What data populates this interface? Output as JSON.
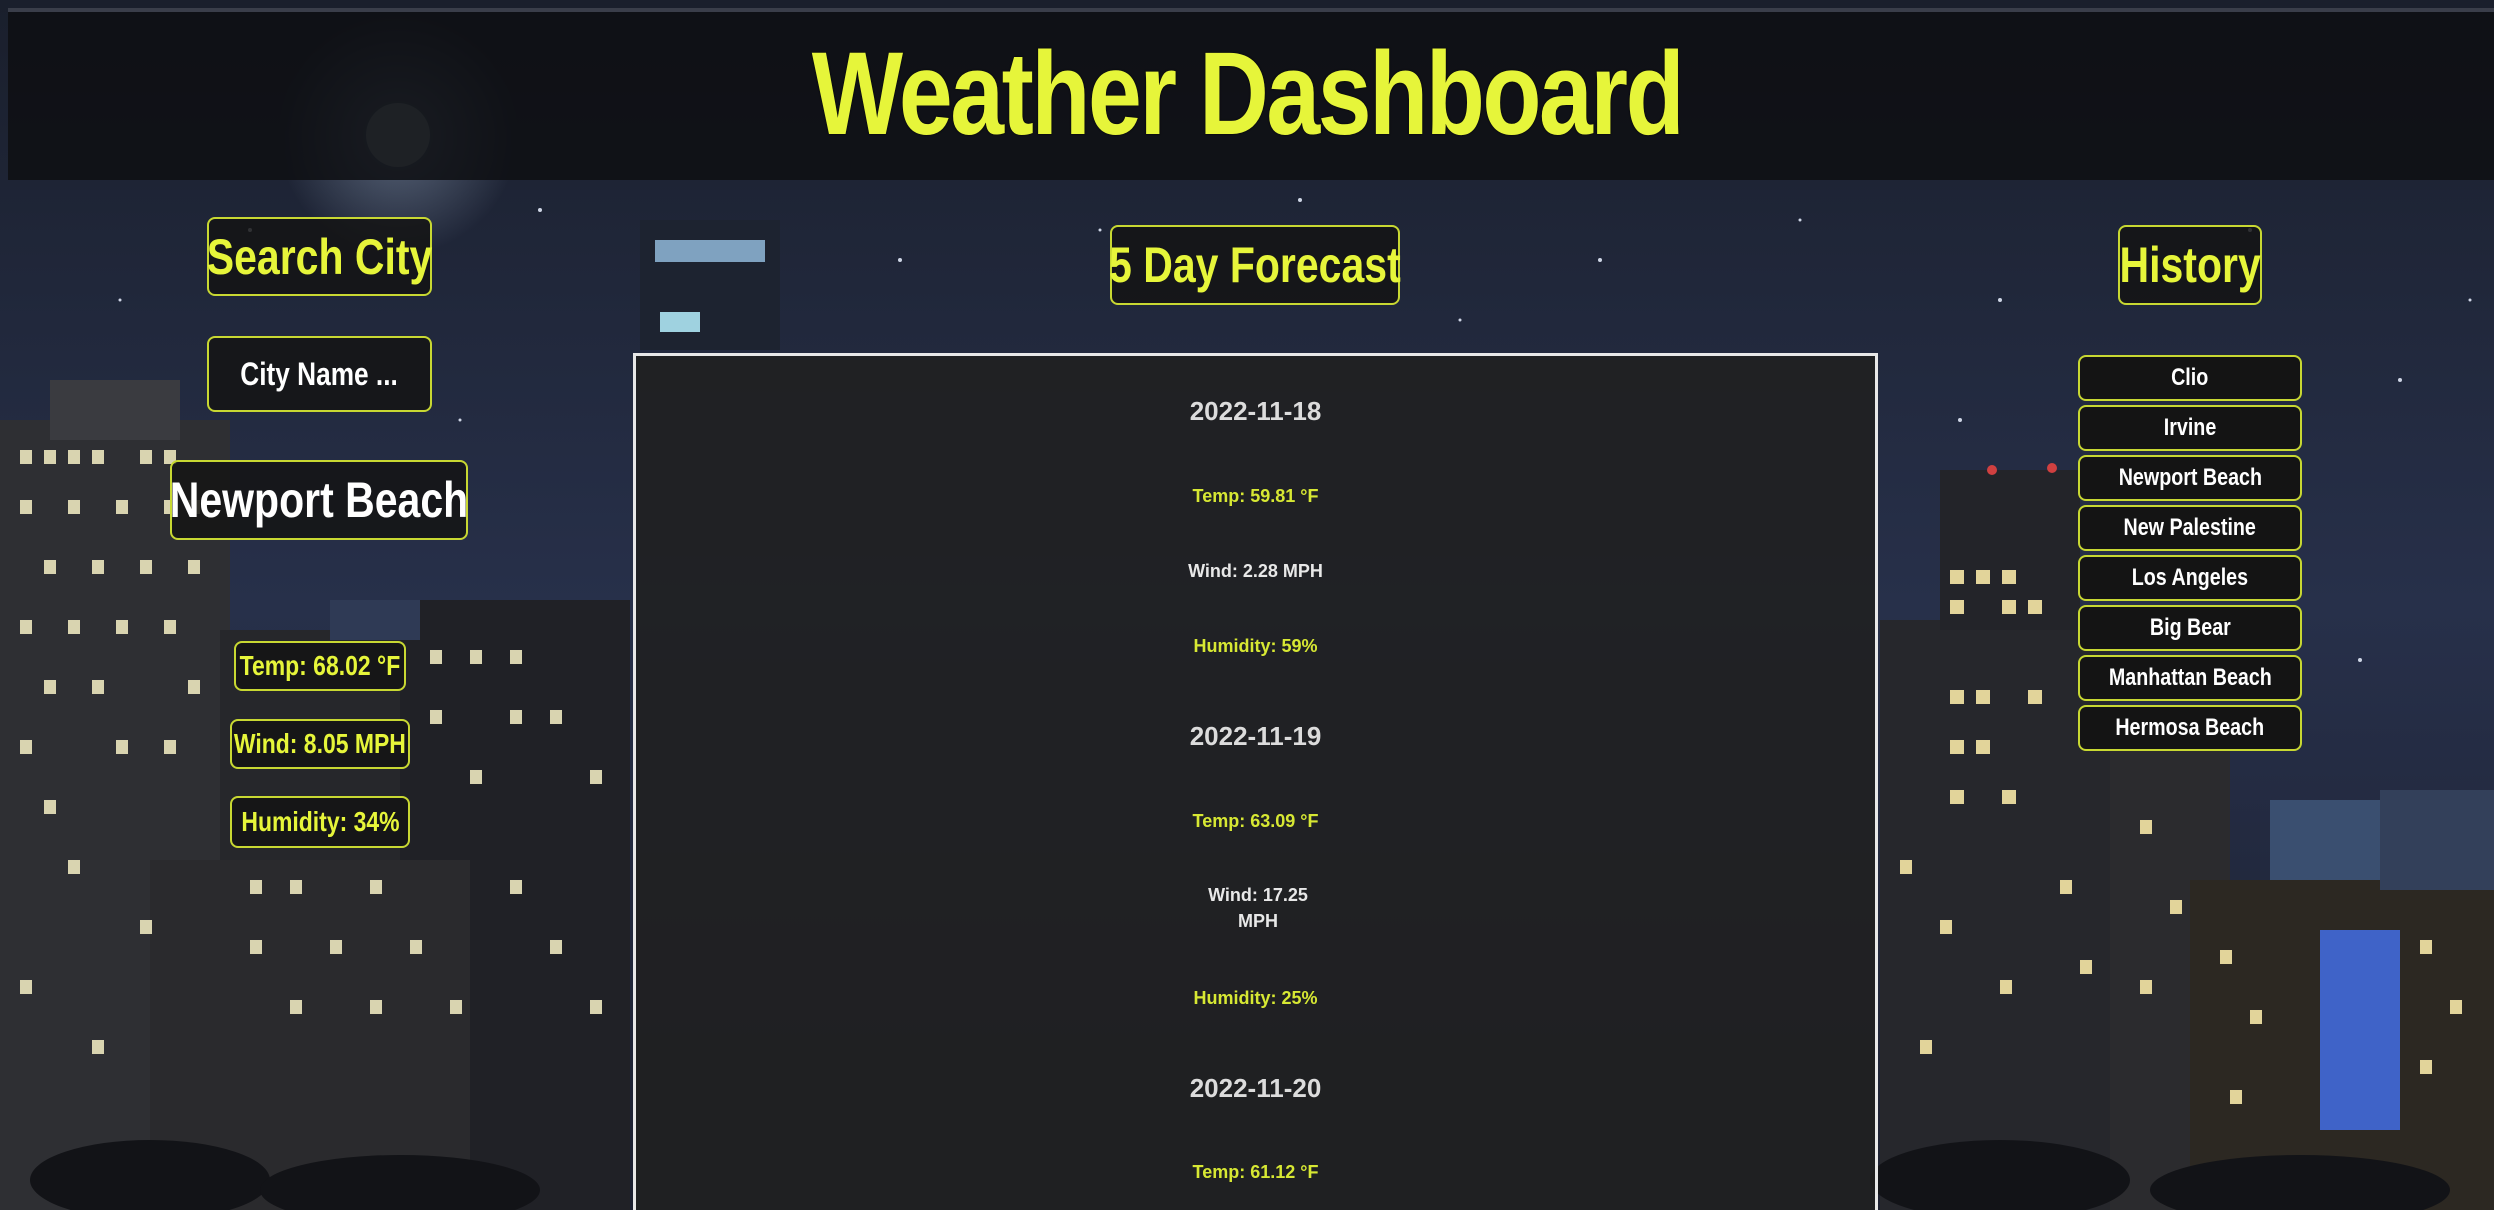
{
  "header": {
    "title": "Weather Dashboard"
  },
  "search": {
    "heading": "Search City",
    "placeholder": "City Name ..."
  },
  "current": {
    "city": "Newport Beach",
    "temp": "Temp: 68.02 °F",
    "wind": "Wind: 8.05 MPH",
    "humidity": "Humidity: 34%"
  },
  "forecast": {
    "heading": "5 Day Forecast",
    "days": [
      {
        "date": "2022-11-18",
        "temp": "Temp: 59.81 °F",
        "wind": "Wind: 2.28 MPH",
        "humidity": "Humidity: 59%"
      },
      {
        "date": "2022-11-19",
        "temp": "Temp: 63.09 °F",
        "wind": "Wind: 17.25 MPH",
        "humidity": "Humidity: 25%"
      },
      {
        "date": "2022-11-20",
        "temp": "Temp: 61.12 °F"
      }
    ]
  },
  "history": {
    "heading": "History",
    "items": [
      "Clio",
      "Irvine",
      "Newport Beach",
      "New Palestine",
      "Los Angeles",
      "Big Bear",
      "Manhattan Beach",
      "Hermosa Beach"
    ]
  },
  "colors": {
    "accent": "#e6f53a",
    "border": "#c8d832",
    "panel": "#202020"
  }
}
